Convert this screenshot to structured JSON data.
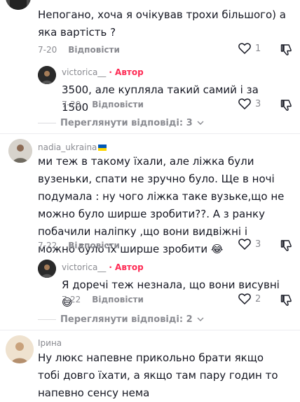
{
  "comments": [
    {
      "body": "Непогано, хоча я очікував трохи більшого) а яка вартість ?",
      "date": "7-20",
      "reply_label": "Відповісти",
      "likes": "1",
      "replies": [
        {
          "username": "victorica__",
          "badge": "· Автор",
          "body": "3500, але купляла такий самий і за 1500",
          "date": "7-20",
          "reply_label": "Відповісти",
          "likes": "3"
        }
      ],
      "view_more": "Переглянути відповіді: 3"
    },
    {
      "username": "nadia_ukraina",
      "flag": "ukraine-flag",
      "body": "ми теж в такому їхали, але ліжка були вузеньки, спати не зручно було. Ще в ночі подумала : ну чого ліжка таке вузьке,що не можно було ширше зробити??. А з ранку побачили наліпку ,що вони видвіжні і можно було їх ширше зробити 😂",
      "date": "7-22",
      "reply_label": "Відповісти",
      "likes": "3",
      "replies": [
        {
          "username": "victorica__",
          "badge": "· Автор",
          "body": "Я доречі теж незнала, що вони висувні😅",
          "date": "7-22",
          "reply_label": "Відповісти",
          "likes": "2"
        }
      ],
      "view_more": "Переглянути відповіді: 2"
    },
    {
      "username": "Ірина",
      "body": "Ну люкс напевне прикольно брати якщо тобі довго їхати, а якщо там пару годин то напевно сенсу нема"
    }
  ],
  "colors": {
    "author": "#fe2c55",
    "muted": "#8a8b91",
    "text": "#161823"
  }
}
